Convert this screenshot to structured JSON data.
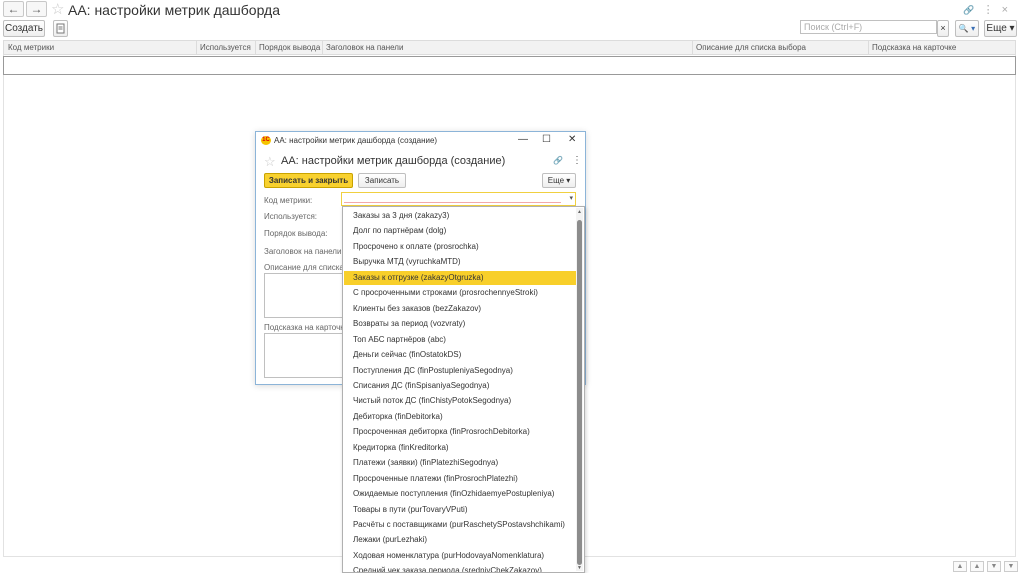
{
  "window": {
    "title": "АА: настройки метрик дашборда",
    "back_icon": "←",
    "forward_icon": "→",
    "star_icon": "☆",
    "link_icon": "🔗",
    "menu_icon": "⋮",
    "close_icon": "×"
  },
  "toolbar": {
    "create_label": "Создать",
    "search_placeholder": "Поиск (Ctrl+F)",
    "clear_icon": "×",
    "search_icon": "🔍 ▾",
    "more_label": "Еще ▾"
  },
  "table": {
    "columns": [
      "Код метрики",
      "Используется",
      "Порядок вывода",
      "Заголовок на панели",
      "Описание для списка выбора",
      "Подсказка на карточке"
    ]
  },
  "footer": {
    "buttons": [
      "▲",
      "▲",
      "▼",
      "▼"
    ]
  },
  "modal": {
    "window_title": "АА: настройки метрик дашборда (создание)",
    "logo_text": "1C",
    "minimize_icon": "—",
    "maximize_icon": "☐",
    "close_icon": "✕",
    "star_icon": "☆",
    "title": "АА: настройки метрик дашборда (создание)",
    "link_icon": "🔗",
    "menu_icon": "⋮",
    "save_close_label": "Записать и закрыть",
    "save_label": "Записать",
    "more_label": "Еще ▾",
    "combo_arrow": "▾",
    "fields": {
      "metric_code": "Код метрики:",
      "used": "Используется:",
      "order": "Порядок вывода:",
      "header": "Заголовок на панели:",
      "description": "Описание для списка",
      "hint": "Подсказка на карточке"
    }
  },
  "dropdown": {
    "selected_index": 4,
    "scroll_up": "▲",
    "scroll_down": "▼",
    "items": [
      "Заказы за 3 дня (zakazy3)",
      "Долг по партнёрам (dolg)",
      "Просрочено к оплате (prosrochka)",
      "Выручка МТД (vyruchkaMTD)",
      "Заказы к отгрузке (zakazyOtgruzka)",
      "С просроченными строками (prosrochennyeStroki)",
      "Клиенты без заказов (bezZakazov)",
      "Возвраты за период (vozvraty)",
      "Топ АБС партнёров (abc)",
      "Деньги сейчас (finOstatokDS)",
      "Поступления ДС (finPostupleniyaSegodnya)",
      "Списания ДС (finSpisaniyaSegodnya)",
      "Чистый поток ДС (finChistyPotokSegodnya)",
      "Дебиторка (finDebitorka)",
      "Просроченная дебиторка (finProsrochDebitorka)",
      "Кредиторка (finKreditorka)",
      "Платежи (заявки) (finPlatezhiSegodnya)",
      "Просроченные платежи (finProsrochPlatezhi)",
      "Ожидаемые поступления (finOzhidaemyePostupleniya)",
      "Товары в пути (purTovaryVPuti)",
      "Расчёты с поставщиками (purRaschetySPostavshchikami)",
      "Лежаки (purLezhaki)",
      "Ходовая номенклатура (purHodovayaNomenklatura)",
      "Средний чек заказа периода (sredniyChekZakazov)"
    ]
  }
}
